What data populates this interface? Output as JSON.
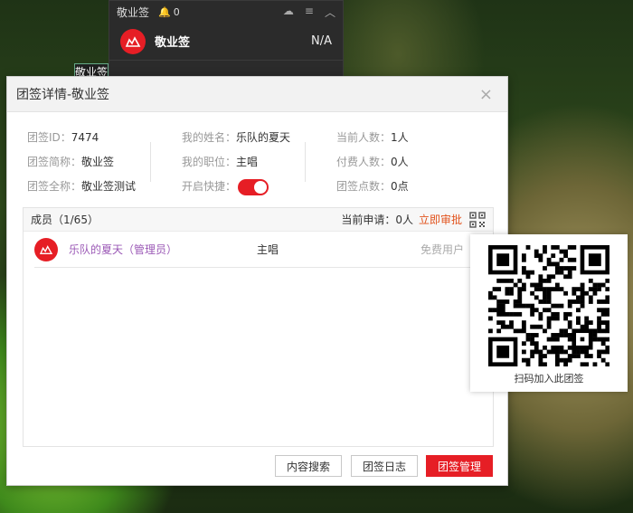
{
  "background_widget": {
    "title": "敬业签",
    "notify_count": "0",
    "group_name": "敬业签",
    "status": "N/A",
    "minimized_tab": "敬业签"
  },
  "dialog": {
    "title": "团签详情-敬业签",
    "close_glyph": "×"
  },
  "info": {
    "team_id_label": "团签ID：",
    "team_id": "7474",
    "short_name_label": "团签简称：",
    "short_name": "敬业签",
    "full_name_label": "团签全称：",
    "full_name": "敬业签测试",
    "my_name_label": "我的姓名：",
    "my_name": "乐队的夏天",
    "my_role_label": "我的职位：",
    "my_role": "主唱",
    "shortcut_label": "开启快捷：",
    "shortcut_enabled": true,
    "current_count_label": "当前人数：",
    "current_count": "1人",
    "paid_count_label": "付费人数：",
    "paid_count": "0人",
    "points_label": "团签点数：",
    "points": "0点"
  },
  "members": {
    "header_label": "成员（1/65）",
    "pending_label": "当前申请：",
    "pending_count": "0人",
    "approve_label": "立即审批",
    "rows": [
      {
        "name": "乐队的夏天（管理员）",
        "role": "主唱",
        "type": "免费用户"
      }
    ]
  },
  "buttons": {
    "search": "内容搜索",
    "log": "团签日志",
    "manage": "团签管理"
  },
  "qr_popup": {
    "caption": "扫码加入此团签"
  },
  "colors": {
    "brand_red": "#e61e25",
    "approve_orange": "#e2531d",
    "member_name": "#9b59b6"
  }
}
